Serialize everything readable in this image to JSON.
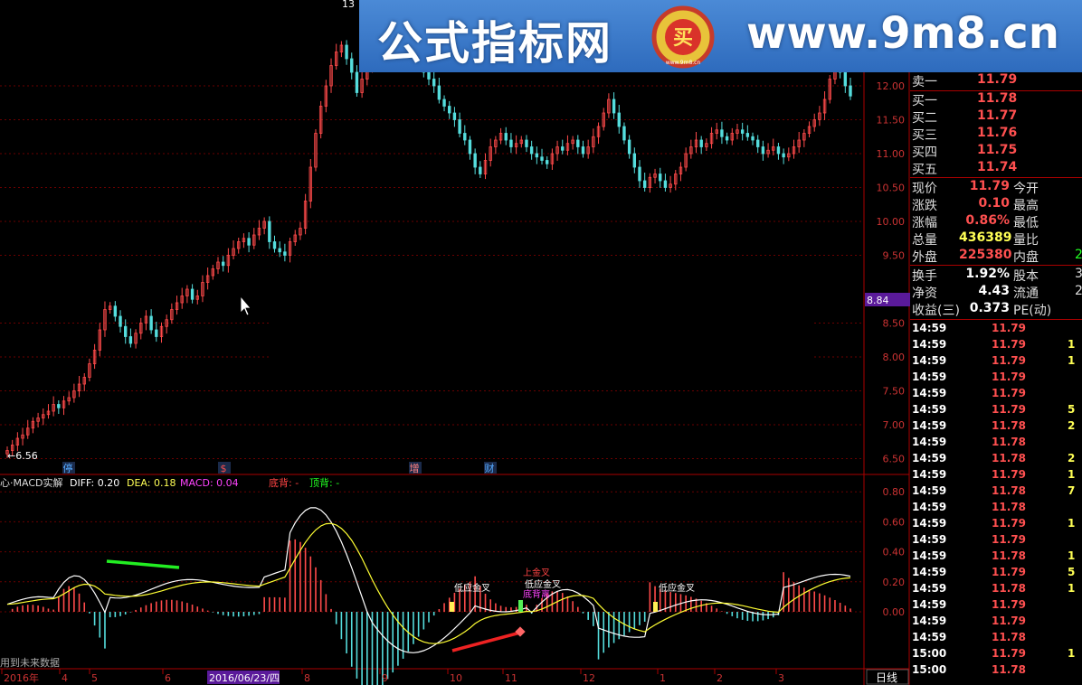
{
  "price_axis": [
    "12.00",
    "11.50",
    "11.00",
    "10.50",
    "10.00",
    "9.50",
    "8.84",
    "8.50",
    "8.00",
    "7.50",
    "7.00",
    "6.50"
  ],
  "price_hover_value": "8.84",
  "low_marker": "←6.56",
  "high_marker": "13",
  "event_marks": [
    {
      "label": "停",
      "color": "#55aaff"
    },
    {
      "label": "$",
      "color": "#ff5050"
    },
    {
      "label": "增",
      "color": "#ff8080"
    },
    {
      "label": "财",
      "color": "#55aaff"
    }
  ],
  "indicator": {
    "name": "心·MACD实解",
    "diff_label": "DIFF: 0.20",
    "dea_label": "DEA: 0.18",
    "macd_label": "MACD: 0.04",
    "bottom_div_label": "底背: -",
    "top_div_label": "顶背: -",
    "axis": [
      "0.80",
      "0.60",
      "0.40",
      "0.20",
      "0.00"
    ],
    "future_data_note": "用到未来数据",
    "signals": [
      {
        "label": "低应金叉",
        "color": "#ffffff"
      },
      {
        "label": "低应金叉",
        "color": "#ffffff"
      },
      {
        "label": "低应金叉",
        "color": "#ffffff"
      },
      {
        "label": "上金叉",
        "color": "#ff4444"
      },
      {
        "label": "底背离",
        "color": "#ff44ff"
      }
    ]
  },
  "time_axis": {
    "labels": [
      "2016年",
      "4",
      "5",
      "6",
      "2016/06/23/四",
      "8",
      "9",
      "10",
      "11",
      "12",
      "1",
      "2",
      "3"
    ],
    "period": "日线"
  },
  "banner": {
    "title": "公式指标网",
    "url": "www.9m8.cn",
    "logo_char": "买",
    "logo_small": "www.9m8.cn",
    "bg": "#3a7acb"
  },
  "quote_panel": {
    "sell_rows": [
      {
        "label": "卖一",
        "price": "11.79"
      }
    ],
    "buy_rows": [
      {
        "label": "买一",
        "price": "11.78"
      },
      {
        "label": "买二",
        "price": "11.77"
      },
      {
        "label": "买三",
        "price": "11.76"
      },
      {
        "label": "买四",
        "price": "11.75"
      },
      {
        "label": "买五",
        "price": "11.74"
      }
    ],
    "stats": [
      {
        "label": "现价",
        "value": "11.79",
        "color": "#ff5050",
        "label2": "今开",
        "value2": ""
      },
      {
        "label": "涨跌",
        "value": "0.10",
        "color": "#ff5050",
        "label2": "最高",
        "value2": ""
      },
      {
        "label": "涨幅",
        "value": "0.86%",
        "color": "#ff5050",
        "label2": "最低",
        "value2": ""
      },
      {
        "label": "总量",
        "value": "436389",
        "color": "#ffff55",
        "label2": "量比",
        "value2": ""
      },
      {
        "label": "外盘",
        "value": "225380",
        "color": "#ff5050",
        "label2": "内盘",
        "value2": "2"
      }
    ],
    "stats2": [
      {
        "label": "换手",
        "value": "1.92%",
        "label2": "股本",
        "value2": "3"
      },
      {
        "label": "净资",
        "value": "4.43",
        "label2": "流通",
        "value2": "2"
      },
      {
        "label": "收益(三)",
        "value": "0.373",
        "label2": "PE(动)",
        "value2": ""
      }
    ]
  },
  "ticks": [
    {
      "time": "14:59",
      "price": "11.79",
      "vol": "",
      "pc": "#ff5050"
    },
    {
      "time": "14:59",
      "price": "11.79",
      "vol": "1",
      "pc": "#ff5050"
    },
    {
      "time": "14:59",
      "price": "11.79",
      "vol": "1",
      "pc": "#ff5050"
    },
    {
      "time": "14:59",
      "price": "11.79",
      "vol": "",
      "pc": "#ff5050"
    },
    {
      "time": "14:59",
      "price": "11.79",
      "vol": "",
      "pc": "#ff5050"
    },
    {
      "time": "14:59",
      "price": "11.79",
      "vol": "5",
      "pc": "#ff5050"
    },
    {
      "time": "14:59",
      "price": "11.78",
      "vol": "2",
      "pc": "#ff5050"
    },
    {
      "time": "14:59",
      "price": "11.78",
      "vol": "",
      "pc": "#ff5050"
    },
    {
      "time": "14:59",
      "price": "11.78",
      "vol": "2",
      "pc": "#ff5050"
    },
    {
      "time": "14:59",
      "price": "11.79",
      "vol": "1",
      "pc": "#ff5050"
    },
    {
      "time": "14:59",
      "price": "11.78",
      "vol": "7",
      "pc": "#ff5050"
    },
    {
      "time": "14:59",
      "price": "11.78",
      "vol": "",
      "pc": "#ff5050"
    },
    {
      "time": "14:59",
      "price": "11.79",
      "vol": "1",
      "pc": "#ff5050"
    },
    {
      "time": "14:59",
      "price": "11.79",
      "vol": "",
      "pc": "#ff5050"
    },
    {
      "time": "14:59",
      "price": "11.78",
      "vol": "1",
      "pc": "#ff5050"
    },
    {
      "time": "14:59",
      "price": "11.79",
      "vol": "5",
      "pc": "#ff5050"
    },
    {
      "time": "14:59",
      "price": "11.78",
      "vol": "1",
      "pc": "#ff5050"
    },
    {
      "time": "14:59",
      "price": "11.79",
      "vol": "",
      "pc": "#ff5050"
    },
    {
      "time": "14:59",
      "price": "11.79",
      "vol": "",
      "pc": "#ff5050"
    },
    {
      "time": "14:59",
      "price": "11.78",
      "vol": "",
      "pc": "#ff5050"
    },
    {
      "time": "15:00",
      "price": "11.79",
      "vol": "1",
      "pc": "#ff5050"
    },
    {
      "time": "15:00",
      "price": "11.78",
      "vol": "",
      "pc": "#ff5050"
    }
  ],
  "colors": {
    "up": "#ff4a4a",
    "down": "#55dddd",
    "diff": "#ffffff",
    "dea": "#ffff33",
    "grid": "#6a0000",
    "axis": "#aa0000",
    "bull_div": "#22ee22",
    "bear_div": "#ee2222"
  }
}
